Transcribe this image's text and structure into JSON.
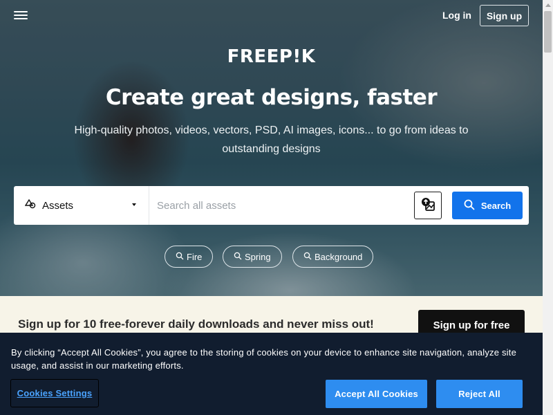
{
  "header": {
    "menu_icon": "hamburger-menu-icon",
    "login_label": "Log in",
    "signup_label": "Sign up"
  },
  "hero": {
    "logo_text": "FREEP!K",
    "headline": "Create great designs, faster",
    "subtitle": "High-quality photos, videos, vectors, PSD, AI images, icons... to go from ideas to outstanding designs"
  },
  "search": {
    "asset_type_icon": "shapes-icon",
    "asset_type_selected": "Assets",
    "placeholder": "Search all assets",
    "image_search_icon": "image-search-icon",
    "button_label": "Search",
    "button_color": "#1273eb"
  },
  "suggestions": [
    {
      "label": "Fire"
    },
    {
      "label": "Spring"
    },
    {
      "label": "Background"
    }
  ],
  "promo": {
    "text": "Sign up for 10 free-forever daily downloads and never miss out!",
    "button_label": "Sign up for free"
  },
  "cookie_banner": {
    "text": "By clicking “Accept All Cookies”, you agree to the storing of cookies on your device to enhance site navigation, analyze site usage, and assist in our marketing efforts.",
    "settings_label": "Cookies Settings",
    "accept_label": "Accept All Cookies",
    "reject_label": "Reject All",
    "accent_color": "#2e8df0",
    "background_color": "#111d2f"
  }
}
